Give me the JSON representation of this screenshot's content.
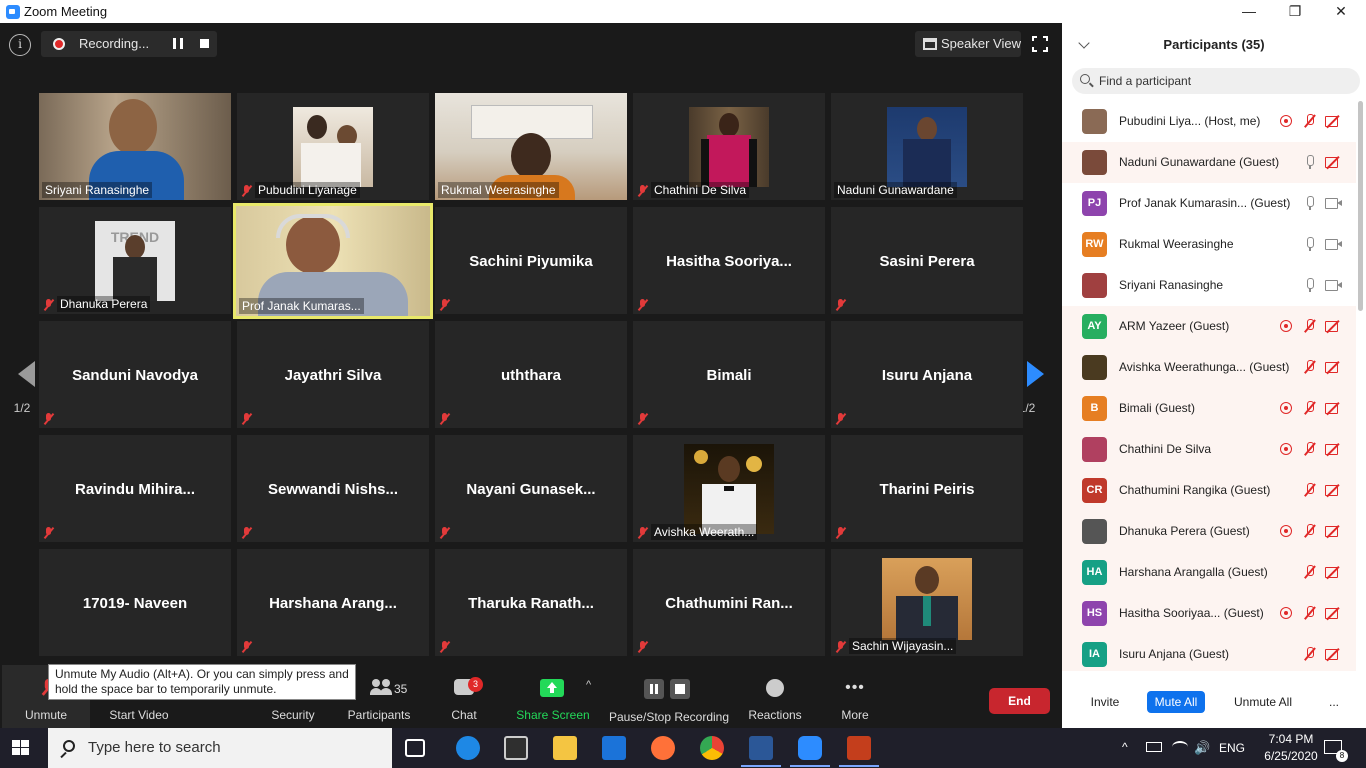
{
  "window": {
    "title": "Zoom Meeting",
    "controls": [
      "—",
      "❐",
      "✕"
    ]
  },
  "meeting": {
    "info_icon": "info-icon",
    "recording_label": "Recording...",
    "speaker_view_label": "Speaker View",
    "page_indicator_left": "1/2",
    "page_indicator_right": "1/2",
    "tiles": [
      {
        "name": "Sriyani Ranasinghe",
        "video": true,
        "muted": false
      },
      {
        "name": "Pubudini Liyanage",
        "video": true,
        "muted": true
      },
      {
        "name": "Rukmal Weerasinghe",
        "video": true,
        "muted": false
      },
      {
        "name": "Chathini De Silva",
        "video": true,
        "muted": true
      },
      {
        "name": "Naduni Gunawardane",
        "video": true,
        "muted": false
      },
      {
        "name": "Dhanuka Perera",
        "video": true,
        "muted": true
      },
      {
        "name": "Prof Janak Kumaras...",
        "video": true,
        "muted": false,
        "active": true
      },
      {
        "name": "Sachini Piyumika",
        "video": false,
        "muted": true
      },
      {
        "name": "Hasitha  Sooriya...",
        "video": false,
        "muted": true
      },
      {
        "name": "Sasini Perera",
        "video": false,
        "muted": true
      },
      {
        "name": "Sanduni Navodya",
        "video": false,
        "muted": true
      },
      {
        "name": "Jayathri Silva",
        "video": false,
        "muted": true
      },
      {
        "name": "uththara",
        "video": false,
        "muted": true
      },
      {
        "name": "Bimali",
        "video": false,
        "muted": true
      },
      {
        "name": "Isuru Anjana",
        "video": false,
        "muted": true
      },
      {
        "name": "Ravindu  Mihira...",
        "video": false,
        "muted": true
      },
      {
        "name": "Sewwandi  Nishs...",
        "video": false,
        "muted": true
      },
      {
        "name": "Nayani  Gunasek...",
        "video": false,
        "muted": true
      },
      {
        "name": "Avishka Weerath...",
        "video": true,
        "muted": true
      },
      {
        "name": "Tharini Peiris",
        "video": false,
        "muted": true
      },
      {
        "name": "17019- Naveen",
        "video": false,
        "muted": false
      },
      {
        "name": "Harshana  Arang...",
        "video": false,
        "muted": true
      },
      {
        "name": "Tharuka  Ranath...",
        "video": false,
        "muted": true
      },
      {
        "name": "Chathumini  Ran...",
        "video": false,
        "muted": true
      },
      {
        "name": "Sachin Wijayasin...",
        "video": true,
        "muted": true
      }
    ]
  },
  "toolbar": {
    "tooltip": "Unmute My Audio (Alt+A). Or you can simply press and hold the space bar to temporarily unmute.",
    "unmute": "Unmute",
    "start_video": "Start Video",
    "security": "Security",
    "participants": "Participants",
    "participants_count": "35",
    "chat": "Chat",
    "chat_badge": "3",
    "share_screen": "Share Screen",
    "recording": "Pause/Stop Recording",
    "reactions": "Reactions",
    "more": "More",
    "end": "End"
  },
  "panel": {
    "title": "Participants (35)",
    "search_placeholder": "Find a participant",
    "participants": [
      {
        "name": "Pubudini Liya...    (Host, me)",
        "initials": "",
        "color": "#8a6a55",
        "rec": true,
        "mic": "off",
        "cam": "off"
      },
      {
        "name": "Naduni Gunawardane (Guest)",
        "initials": "",
        "color": "#7a4a3a",
        "rec": false,
        "mic": "on",
        "cam": "off"
      },
      {
        "name": "Prof Janak Kumarasin... (Guest)",
        "initials": "PJ",
        "color": "#8e44ad",
        "rec": false,
        "mic": "on",
        "cam": "on"
      },
      {
        "name": "Rukmal Weerasinghe",
        "initials": "RW",
        "color": "#e67e22",
        "rec": false,
        "mic": "on",
        "cam": "on"
      },
      {
        "name": "Sriyani Ranasinghe",
        "initials": "",
        "color": "#a04040",
        "rec": false,
        "mic": "on",
        "cam": "on"
      },
      {
        "name": "ARM Yazeer (Guest)",
        "initials": "AY",
        "color": "#27ae60",
        "rec": true,
        "mic": "off",
        "cam": "off"
      },
      {
        "name": "Avishka Weerathunga... (Guest)",
        "initials": "",
        "color": "#4a3a20",
        "rec": false,
        "mic": "off",
        "cam": "off"
      },
      {
        "name": "Bimali (Guest)",
        "initials": "B",
        "color": "#e67e22",
        "rec": true,
        "mic": "off",
        "cam": "off"
      },
      {
        "name": "Chathini De Silva",
        "initials": "",
        "color": "#b04060",
        "rec": true,
        "mic": "off",
        "cam": "off"
      },
      {
        "name": "Chathumini Rangika (Guest)",
        "initials": "CR",
        "color": "#c0392b",
        "rec": false,
        "mic": "off",
        "cam": "off"
      },
      {
        "name": "Dhanuka Perera (Guest)",
        "initials": "",
        "color": "#555555",
        "rec": true,
        "mic": "off",
        "cam": "off"
      },
      {
        "name": "Harshana Arangalla (Guest)",
        "initials": "HA",
        "color": "#16a085",
        "rec": false,
        "mic": "off",
        "cam": "off"
      },
      {
        "name": "Hasitha Sooriyaa...  (Guest)",
        "initials": "HS",
        "color": "#8e44ad",
        "rec": true,
        "mic": "off",
        "cam": "off"
      },
      {
        "name": "Isuru Anjana (Guest)",
        "initials": "IA",
        "color": "#16a085",
        "rec": false,
        "mic": "off",
        "cam": "off"
      }
    ],
    "invite": "Invite",
    "mute_all": "Mute All",
    "unmute_all": "Unmute All",
    "more": "..."
  },
  "taskbar": {
    "search_placeholder": "Type here to search",
    "lang": "ENG",
    "time": "7:04 PM",
    "date": "6/25/2020",
    "notif_count": "8"
  },
  "colors": {
    "accent": "#2d8cff",
    "end_button": "#c8262e",
    "muted_red": "#e02828",
    "active_speaker": "#e8e86a",
    "share_green": "#23d959"
  }
}
